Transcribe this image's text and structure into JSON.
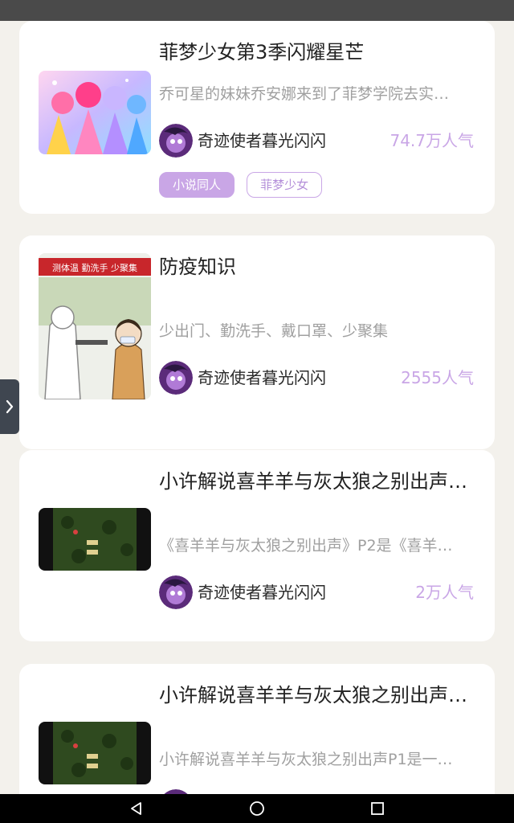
{
  "cards": [
    {
      "title": "菲梦少女第3季闪耀星芒",
      "desc": "乔可星的妹妹乔安娜来到了菲梦学院去实…",
      "author": "奇迹使者暮光闪闪",
      "popularity": "74.7万人气",
      "tags": [
        "小说同人",
        "菲梦少女"
      ]
    },
    {
      "title": "防疫知识",
      "desc": "少出门、勤洗手、戴口罩、少聚集",
      "author": "奇迹使者暮光闪闪",
      "popularity": "2555人气",
      "thumb_banner": "测体温 勤洗手 少聚集"
    },
    {
      "title": "小许解说喜羊羊与灰太狼之别出声…",
      "desc": "《喜羊羊与灰太狼之别出声》P2是《喜羊…",
      "author": "奇迹使者暮光闪闪",
      "popularity": "2万人气"
    },
    {
      "title": "小许解说喜羊羊与灰太狼之别出声…",
      "desc": "小许解说喜羊羊与灰太狼之别出声P1是一…"
    }
  ],
  "icons": {
    "side_handle": "chevron-right-icon",
    "nav_back": "back-triangle-icon",
    "nav_home": "home-circle-icon",
    "nav_recents": "recents-square-icon"
  },
  "colors": {
    "accent": "#c9a6e6",
    "background": "#f3f1ec"
  }
}
